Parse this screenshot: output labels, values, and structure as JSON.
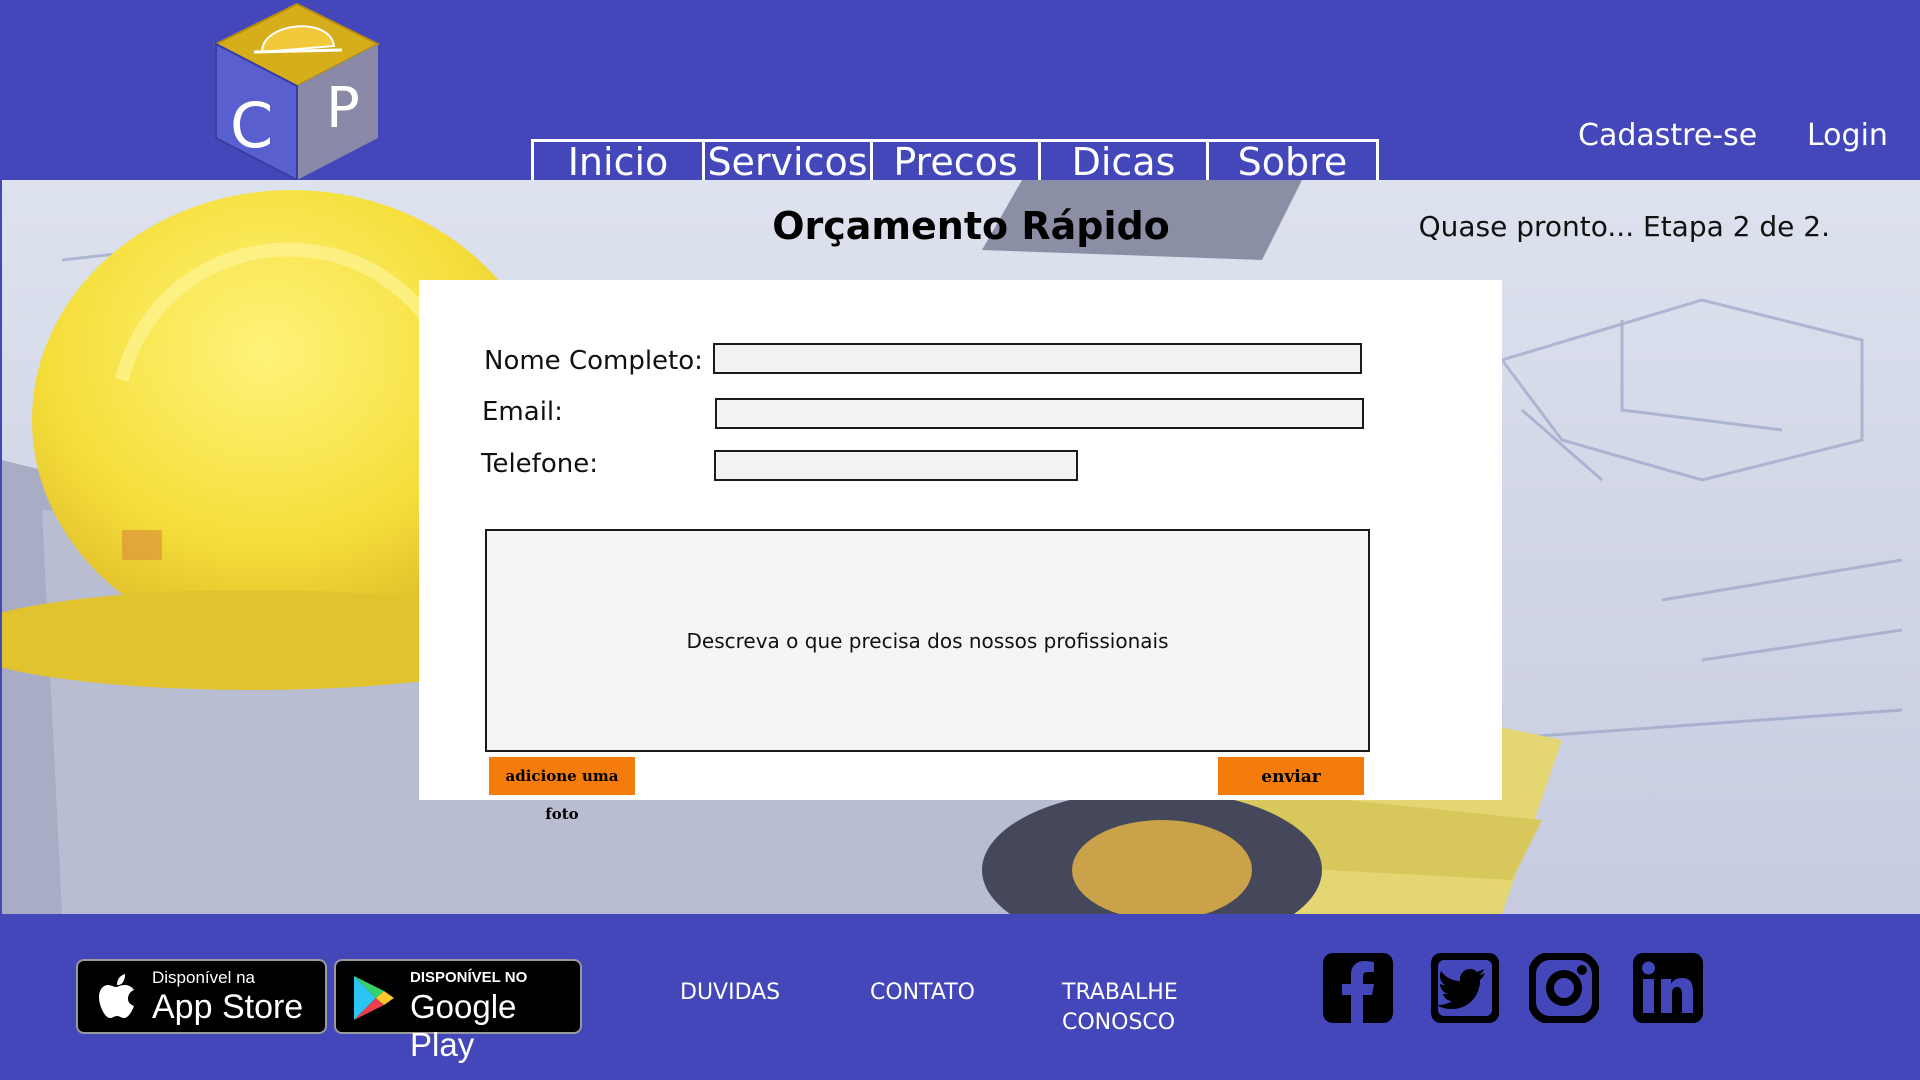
{
  "header": {
    "logo_letters": [
      "C",
      "P"
    ],
    "nav": [
      {
        "label": "Inicio"
      },
      {
        "label": "Servicos"
      },
      {
        "label": "Precos"
      },
      {
        "label": "Dicas"
      },
      {
        "label": "Sobre"
      }
    ],
    "signup_label": "Cadastre-se",
    "login_label": "Login"
  },
  "main": {
    "title": "Orçamento Rápido",
    "step_text": "Quase pronto... Etapa 2 de 2.",
    "form": {
      "name_label": "Nome Completo:",
      "name_value": "",
      "email_label": "Email:",
      "email_value": "",
      "phone_label": "Telefone:",
      "phone_value": "",
      "description_placeholder": "Descreva o que precisa dos nossos profissionais",
      "photo_button": "adicione uma foto",
      "send_button": "enviar"
    }
  },
  "footer": {
    "app_store": {
      "small": "Disponível na",
      "big": "App Store"
    },
    "google_play": {
      "small": "DISPONÍVEL NO",
      "big": "Google Play"
    },
    "links": {
      "duvidas": "DUVIDAS",
      "contato": "CONTATO",
      "trabalhe_1": "TRABALHE",
      "trabalhe_2": "CONOSCO"
    },
    "social": [
      "facebook-icon",
      "twitter-icon",
      "instagram-icon",
      "linkedin-icon"
    ]
  },
  "colors": {
    "brand_blue": "#4447b9",
    "accent_orange": "#f57c0a",
    "logo_gold": "#d6ad1a",
    "logo_blue": "#5a5fd0"
  }
}
